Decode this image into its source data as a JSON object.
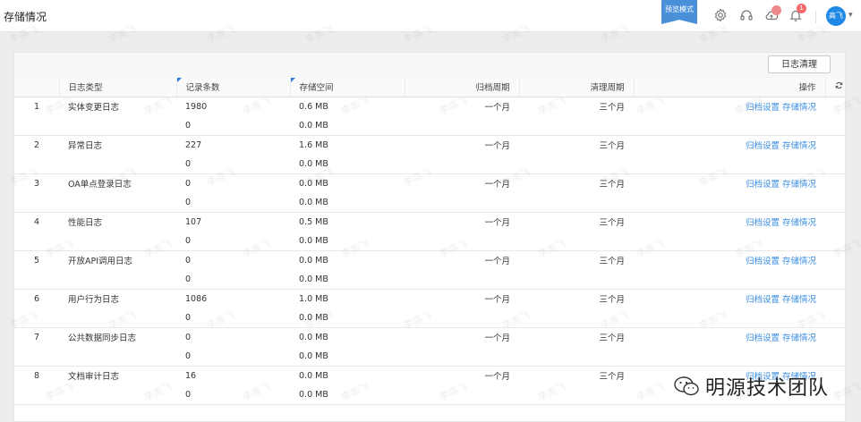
{
  "header": {
    "title": "存储情况",
    "preview_badge": "预览模式",
    "notification_count": "1",
    "user_avatar": "高飞"
  },
  "toolbar": {
    "clean_button": "日志清理"
  },
  "table": {
    "columns": [
      "日志类型",
      "记录条数",
      "存储空间",
      "归档周期",
      "清理周期",
      "操作"
    ],
    "rows": [
      {
        "index": "1",
        "type": "实体变更日志",
        "records": "1980",
        "records_archive": "0",
        "storage": "0.6 MB",
        "storage_archive": "0.0 MB",
        "archive_period": "一个月",
        "clean_period": "三个月",
        "op_archive": "归档设置",
        "op_storage": "存储情况"
      },
      {
        "index": "2",
        "type": "异常日志",
        "records": "227",
        "records_archive": "0",
        "storage": "1.6 MB",
        "storage_archive": "0.0 MB",
        "archive_period": "一个月",
        "clean_period": "三个月",
        "op_archive": "归档设置",
        "op_storage": "存储情况"
      },
      {
        "index": "3",
        "type": "OA单点登录日志",
        "records": "0",
        "records_archive": "0",
        "storage": "0.0 MB",
        "storage_archive": "0.0 MB",
        "archive_period": "一个月",
        "clean_period": "三个月",
        "op_archive": "归档设置",
        "op_storage": "存储情况"
      },
      {
        "index": "4",
        "type": "性能日志",
        "records": "107",
        "records_archive": "0",
        "storage": "0.5 MB",
        "storage_archive": "0.0 MB",
        "archive_period": "一个月",
        "clean_period": "三个月",
        "op_archive": "归档设置",
        "op_storage": "存储情况"
      },
      {
        "index": "5",
        "type": "开放API调用日志",
        "records": "0",
        "records_archive": "0",
        "storage": "0.0 MB",
        "storage_archive": "0.0 MB",
        "archive_period": "一个月",
        "clean_period": "三个月",
        "op_archive": "归档设置",
        "op_storage": "存储情况"
      },
      {
        "index": "6",
        "type": "用户行为日志",
        "records": "1086",
        "records_archive": "0",
        "storage": "1.0 MB",
        "storage_archive": "0.0 MB",
        "archive_period": "一个月",
        "clean_period": "三个月",
        "op_archive": "归档设置",
        "op_storage": "存储情况"
      },
      {
        "index": "7",
        "type": "公共数据同步日志",
        "records": "0",
        "records_archive": "0",
        "storage": "0.0 MB",
        "storage_archive": "0.0 MB",
        "archive_period": "一个月",
        "clean_period": "三个月",
        "op_archive": "归档设置",
        "op_storage": "存储情况"
      },
      {
        "index": "8",
        "type": "文档审计日志",
        "records": "16",
        "records_archive": "0",
        "storage": "0.0 MB",
        "storage_archive": "0.0 MB",
        "archive_period": "一个月",
        "clean_period": "三个月",
        "op_archive": "归档设置",
        "op_storage": "存储情况"
      }
    ]
  },
  "watermark_text": "李高飞",
  "brand_overlay": "明源技术团队",
  "icons": [
    "settings-icon",
    "headset-icon",
    "cloud-icon",
    "bell-icon",
    "refresh-icon",
    "wechat-icon"
  ],
  "colors": {
    "accent": "#4a90d9",
    "link": "#3b8ee2",
    "badge": "#f56c6c",
    "avatar": "#1e88e5"
  }
}
